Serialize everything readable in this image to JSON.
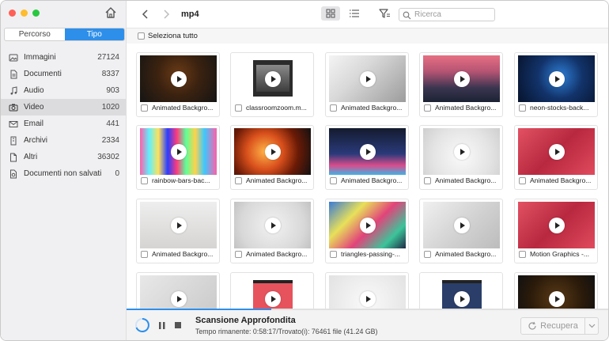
{
  "sidebar": {
    "tabs": [
      {
        "label": "Percorso",
        "active": false
      },
      {
        "label": "Tipo",
        "active": true
      }
    ],
    "items": [
      {
        "label": "Immagini",
        "count": "27124",
        "icon": "image-icon",
        "selected": false
      },
      {
        "label": "Documenti",
        "count": "8337",
        "icon": "document-icon",
        "selected": false
      },
      {
        "label": "Audio",
        "count": "903",
        "icon": "music-note-icon",
        "selected": false
      },
      {
        "label": "Video",
        "count": "1020",
        "icon": "camera-icon",
        "selected": true
      },
      {
        "label": "Email",
        "count": "441",
        "icon": "envelope-icon",
        "selected": false
      },
      {
        "label": "Archivi",
        "count": "2334",
        "icon": "archive-icon",
        "selected": false
      },
      {
        "label": "Altri",
        "count": "36302",
        "icon": "other-files-icon",
        "selected": false
      },
      {
        "label": "Documenti non salvati",
        "count": "0",
        "icon": "unsaved-doc-icon",
        "selected": false
      }
    ]
  },
  "toolbar": {
    "breadcrumb": "mp4",
    "search_placeholder": "Ricerca",
    "select_all_label": "Seleziona tutto"
  },
  "files": [
    {
      "name": "Animated Backgro..."
    },
    {
      "name": "classroomzoom.m..."
    },
    {
      "name": "Animated Backgro..."
    },
    {
      "name": "Animated Backgro..."
    },
    {
      "name": "neon-stocks-back..."
    },
    {
      "name": "rainbow-bars-bac..."
    },
    {
      "name": "Animated Backgro..."
    },
    {
      "name": "Animated Backgro..."
    },
    {
      "name": "Animated Backgro..."
    },
    {
      "name": "Animated Backgro..."
    },
    {
      "name": "Animated Backgro..."
    },
    {
      "name": "Animated Backgro..."
    },
    {
      "name": "triangles-passing-..."
    },
    {
      "name": "Animated Backgro..."
    },
    {
      "name": "Motion Graphics -..."
    },
    {
      "name": ""
    },
    {
      "name": ""
    },
    {
      "name": ""
    },
    {
      "name": ""
    },
    {
      "name": ""
    }
  ],
  "scan": {
    "title": "Scansione Approfondita",
    "status": "Tempo rimanente: 0:58:17/Trovato(i): 76461 file (41.24 GB)",
    "progress": 0.3,
    "recover_label": "Recupera"
  },
  "colors": {
    "accent": "#2e8fea"
  }
}
